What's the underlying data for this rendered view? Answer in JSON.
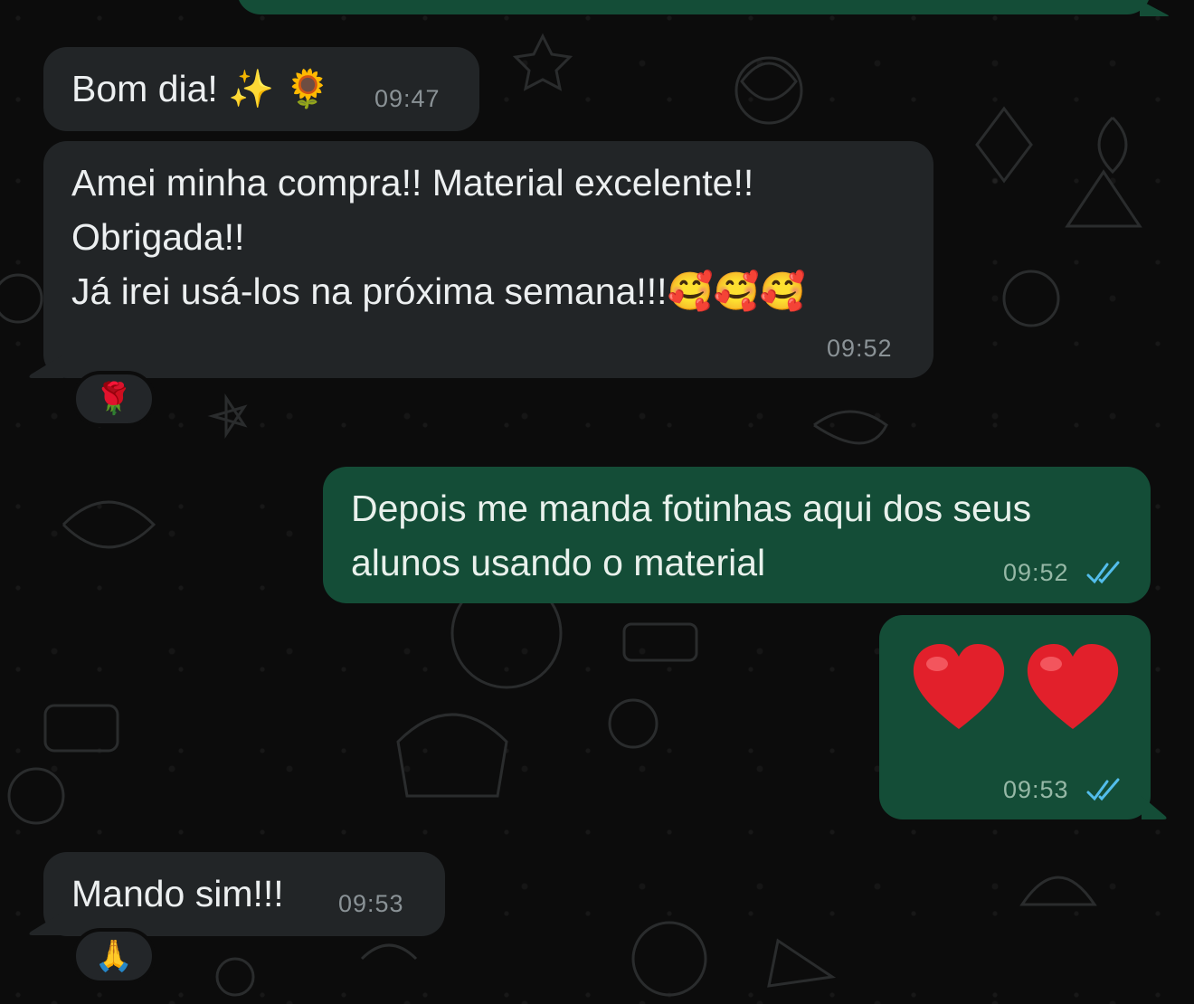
{
  "messages": [
    {
      "id": "m1",
      "direction": "incoming",
      "text": "Bom dia! ✨ 🌻",
      "time": "09:47"
    },
    {
      "id": "m2",
      "direction": "incoming",
      "lines": [
        "Amei minha compra!! Material excelente!!",
        "Obrigada!!",
        "Já irei usá-los na próxima semana!!!🥰🥰🥰"
      ],
      "time": "09:52",
      "reaction": "🌹"
    },
    {
      "id": "m3",
      "direction": "outgoing",
      "lines": [
        "Depois me manda fotinhas aqui dos seus",
        "alunos usando o material"
      ],
      "time": "09:52",
      "status": "read"
    },
    {
      "id": "m4",
      "direction": "outgoing",
      "text": "❤️❤️",
      "time": "09:53",
      "status": "read"
    },
    {
      "id": "m5",
      "direction": "incoming",
      "text": "Mando sim!!!",
      "time": "09:53",
      "reaction": "🙏"
    }
  ],
  "colors": {
    "incoming_bubble": "#222527",
    "outgoing_bubble": "#144d37",
    "read_ticks": "#53bdeb",
    "background": "#0c0c0c"
  },
  "icons": {
    "read_receipt": "double-check-icon",
    "heart": "red-heart-icon",
    "rose": "rose-icon",
    "praying_hands": "praying-hands-icon",
    "sunflower": "sunflower-icon",
    "sparkles": "sparkles-icon",
    "smiling_face_with_hearts": "smiling-face-with-hearts-icon"
  }
}
